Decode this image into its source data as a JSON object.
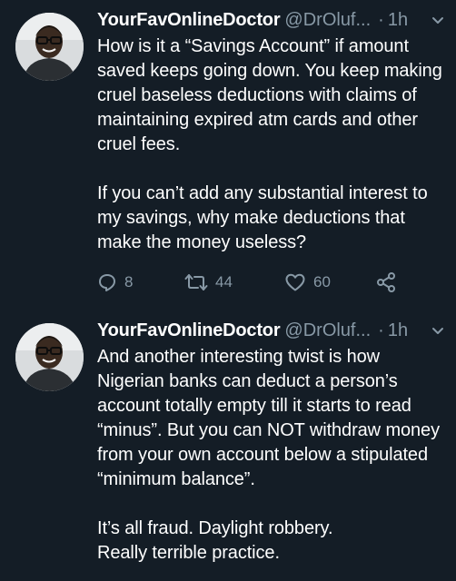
{
  "tweets": [
    {
      "display_name": "YourFavOnlineDoctor",
      "handle": "@DrOluf...",
      "separator": "·",
      "time": "1h",
      "paragraphs": [
        "How is it a “Savings Account” if amount saved keeps going down. You keep making cruel baseless deductions with claims of maintaining expired atm cards and other cruel fees.",
        "If you can’t add any substantial interest to my savings, why make deductions that make the money useless?"
      ],
      "reply_count": "8",
      "retweet_count": "44",
      "like_count": "60"
    },
    {
      "display_name": "YourFavOnlineDoctor",
      "handle": "@DrOluf...",
      "separator": "·",
      "time": "1h",
      "paragraphs": [
        "And another interesting twist is how Nigerian banks can deduct a person’s account totally empty till it starts to read “minus”. But you can NOT withdraw money from your own account below a stipulated “minimum balance”.",
        "It’s all fraud. Daylight robbery.\nReally terrible practice."
      ]
    }
  ],
  "icons": {
    "reply": "reply-icon",
    "retweet": "retweet-icon",
    "like": "heart-icon",
    "share": "share-icon",
    "menu": "chevron-down-icon"
  },
  "colors": {
    "background": "#141d26",
    "text": "#ffffff",
    "muted": "#8899a6"
  }
}
